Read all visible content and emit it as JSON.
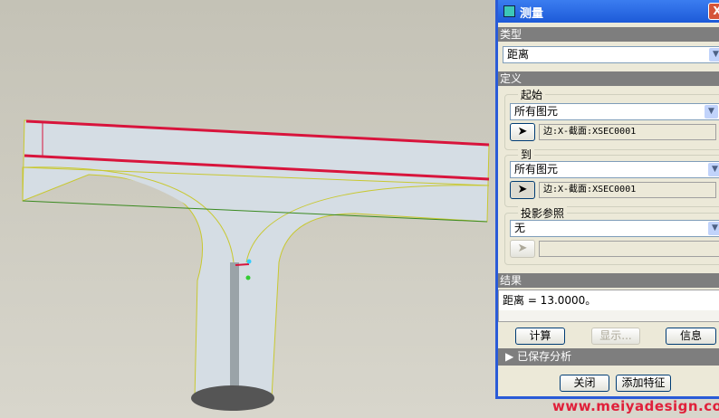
{
  "dialog": {
    "title": "测量",
    "close": "X",
    "type_section": "类型",
    "type_value": "距离",
    "definition_section": "定义",
    "from": {
      "label": "起始",
      "filter": "所有图元",
      "selection": "边:X-截面:XSEC0001"
    },
    "to": {
      "label": "到",
      "filter": "所有图元",
      "selection": "边:X-截面:XSEC0001"
    },
    "projection": {
      "label": "投影参照",
      "value": "无",
      "selection": ""
    },
    "result_section": "结果",
    "result_text": "距离 = 13.0000。",
    "compute": "计算",
    "show": "显示...",
    "info": "信息",
    "saved_analysis": "已保存分析",
    "close_button": "关闭",
    "add_feature": "添加特征"
  },
  "watermark": "www.meiyadesign.com",
  "colors": {
    "accent": "#2a5bd7",
    "part": "#d5dde4",
    "highlight": "#d8143c"
  }
}
